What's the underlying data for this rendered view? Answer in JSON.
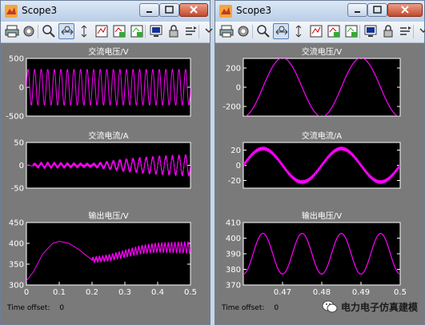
{
  "windows": [
    {
      "title": "Scope3",
      "time_offset_label": "Time offset:",
      "time_offset_value": "0",
      "chart_data": [
        {
          "type": "line",
          "title": "交流电压/V",
          "x_range": [
            0,
            0.5
          ],
          "ylim": [
            -500,
            500
          ],
          "yticks": [
            "500",
            "0",
            "-500"
          ],
          "grid": false,
          "series": [
            {
              "description": "sine amplitude ~310 V, 50 Hz",
              "amplitude": 310,
              "frequency_hz": 50,
              "offset": 0
            }
          ]
        },
        {
          "type": "line",
          "title": "交流电流/A",
          "x_range": [
            0,
            0.5
          ],
          "ylim": [
            -50,
            50
          ],
          "yticks": [
            "50",
            "0",
            "-50"
          ],
          "grid": false,
          "series": [
            {
              "frequency_hz": 50,
              "amplitude_points": [
                [
                  0,
                  0
                ],
                [
                  0.05,
                  5
                ],
                [
                  0.1,
                  4
                ],
                [
                  0.2,
                  2
                ],
                [
                  0.3,
                  12
                ],
                [
                  0.4,
                  18
                ],
                [
                  0.5,
                  22
                ]
              ]
            }
          ]
        },
        {
          "type": "line",
          "title": "输出电压/V",
          "x_range": [
            0,
            0.5
          ],
          "ylim": [
            300,
            450
          ],
          "yticks": [
            "450",
            "400",
            "350",
            "300"
          ],
          "xticks": [
            "0",
            "0.1",
            "0.2",
            "0.3",
            "0.4",
            "0.5"
          ],
          "grid": false,
          "series": [
            {
              "points": [
                [
                  0,
                  310
                ],
                [
                  0.02,
                  330
                ],
                [
                  0.05,
                  375
                ],
                [
                  0.08,
                  400
                ],
                [
                  0.1,
                  405
                ],
                [
                  0.13,
                  400
                ],
                [
                  0.16,
                  385
                ],
                [
                  0.2,
                  360
                ],
                [
                  0.25,
                  365
                ],
                [
                  0.3,
                  375
                ],
                [
                  0.35,
                  385
                ],
                [
                  0.4,
                  390
                ],
                [
                  0.45,
                  390
                ],
                [
                  0.5,
                  390
                ]
              ]
            }
          ]
        }
      ]
    },
    {
      "title": "Scope3",
      "time_offset_label": "Time offset:",
      "time_offset_value": "0",
      "chart_data": [
        {
          "type": "line",
          "title": "交流电压/V",
          "x_range": [
            0.46,
            0.5
          ],
          "ylim": [
            -300,
            300
          ],
          "yticks": [
            "200",
            "0",
            "-200"
          ],
          "grid": false,
          "series": [
            {
              "amplitude": 305,
              "frequency_hz": 50,
              "offset": 0
            }
          ]
        },
        {
          "type": "line",
          "title": "交流电流/A",
          "x_range": [
            0.46,
            0.5
          ],
          "ylim": [
            -30,
            30
          ],
          "yticks": [
            "20",
            "0",
            "-20"
          ],
          "grid": false,
          "series": [
            {
              "amplitude": 22,
              "frequency_hz": 50,
              "ripple": 2
            }
          ]
        },
        {
          "type": "line",
          "title": "输出电压/V",
          "x_range": [
            0.46,
            0.5
          ],
          "ylim": [
            370,
            410
          ],
          "yticks": [
            "410",
            "400",
            "390",
            "380",
            "370"
          ],
          "xticks": [
            "0.47",
            "0.48",
            "0.49",
            "0.5"
          ],
          "grid": false,
          "series": [
            {
              "amplitude": 13,
              "frequency_hz": 100,
              "offset": 390
            }
          ]
        }
      ]
    }
  ],
  "toolbar_icons": [
    "print-icon",
    "parameters-icon",
    "zoom-icon",
    "zoom-x-icon",
    "zoom-y-icon",
    "autoscale-icon",
    "save-axes-icon",
    "restore-axes-icon",
    "floating-scope-icon",
    "lock-icon",
    "signal-selection-icon",
    "more-icon"
  ],
  "watermark": {
    "text": "电力电子仿真建模",
    "icon": "wechat-icon"
  },
  "colors": {
    "trace": "#ff00ff",
    "plot_bg": "#000000",
    "figure_bg": "#7a7a7a"
  }
}
